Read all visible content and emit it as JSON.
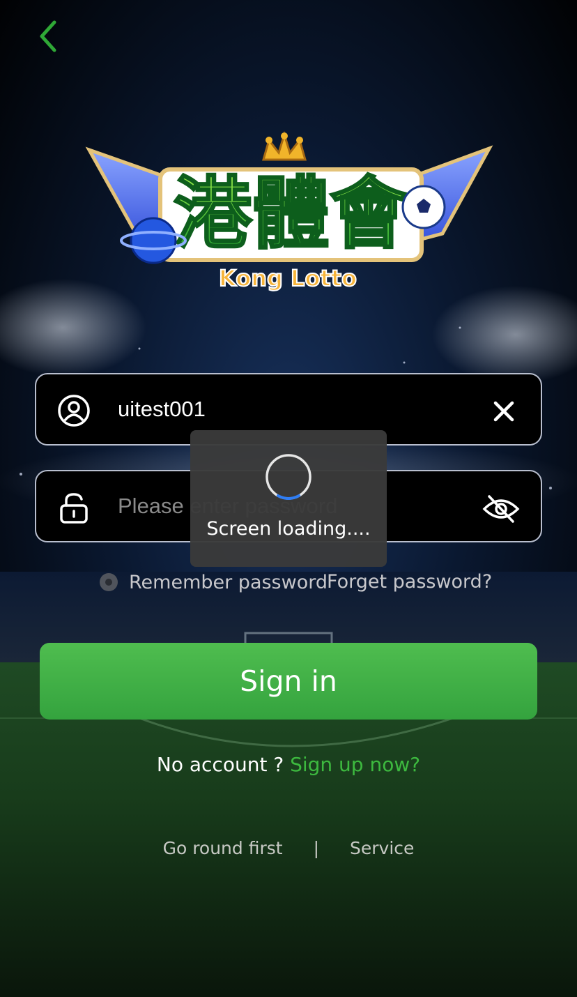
{
  "logo": {
    "title": "港體會",
    "subtitle": "Kong Lotto"
  },
  "login": {
    "username_value": "uitest001",
    "password_placeholder": "Please enter password",
    "remember_label": "Remember password",
    "forget_label": "Forget password?",
    "signin_label": "Sign in"
  },
  "signup": {
    "prompt": "No account ? ",
    "link": "Sign up now?"
  },
  "footer": {
    "go_round": "Go round first",
    "separator": "|",
    "service": "Service"
  },
  "loading": {
    "text": "Screen loading...."
  },
  "icons": {
    "back": "chevron-left-icon",
    "user": "user-circle-icon",
    "clear": "close-icon",
    "lock": "lock-icon",
    "eye": "eye-off-icon"
  },
  "colors": {
    "accent_green": "#3db93f",
    "button_green": "#42b046",
    "field_border": "#b9bfcf",
    "loading_bg": "#3a3a3a"
  }
}
